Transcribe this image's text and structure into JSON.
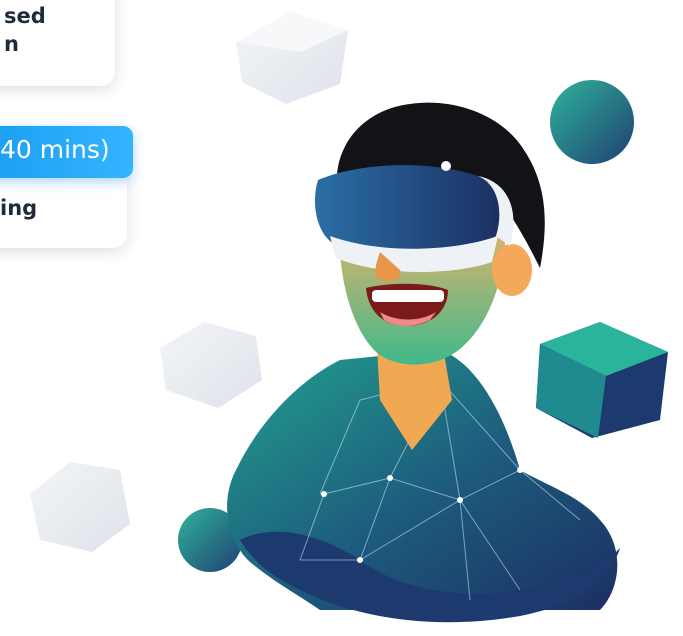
{
  "cards": {
    "top_line1": "sed",
    "top_line2": "n",
    "duration_pill": "40 mins)",
    "mid_line": "ing"
  },
  "colors": {
    "pill_blue": "#1a9cf0",
    "text_dark": "#1f2b3a",
    "teal": "#22a28e",
    "navy": "#1f3a6b"
  },
  "icons": [
    "vr-headset-person-illustration",
    "teal-sphere",
    "cube"
  ]
}
